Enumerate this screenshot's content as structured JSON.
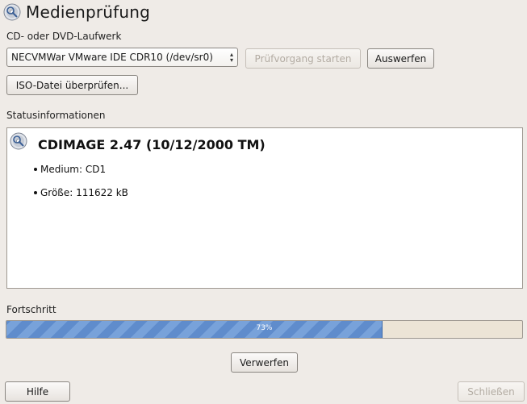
{
  "title": "Medienprüfung",
  "drive_label": "CD- oder DVD-Laufwerk",
  "drive_select_value": "NECVMWar VMware IDE CDR10 (/dev/sr0)",
  "start_check_button": "Prüfvorgang starten",
  "eject_button": "Auswerfen",
  "iso_check_button": "ISO-Datei überprüfen...",
  "status_label": "Statusinformationen",
  "status": {
    "title": "CDIMAGE 2.47 (10/12/2000 TM)",
    "items": [
      "Medium: CD1",
      "Größe: 111622 kB"
    ]
  },
  "progress_label": "Fortschritt",
  "progress": {
    "value": 0.73,
    "text": "73%"
  },
  "discard_button": "Verwerfen",
  "help_button": "Hilfe",
  "close_button": "Schließen",
  "colors": {
    "progress_fill": "#6d97d3",
    "progress_track": "#ece4d6",
    "background": "#efebe7"
  }
}
